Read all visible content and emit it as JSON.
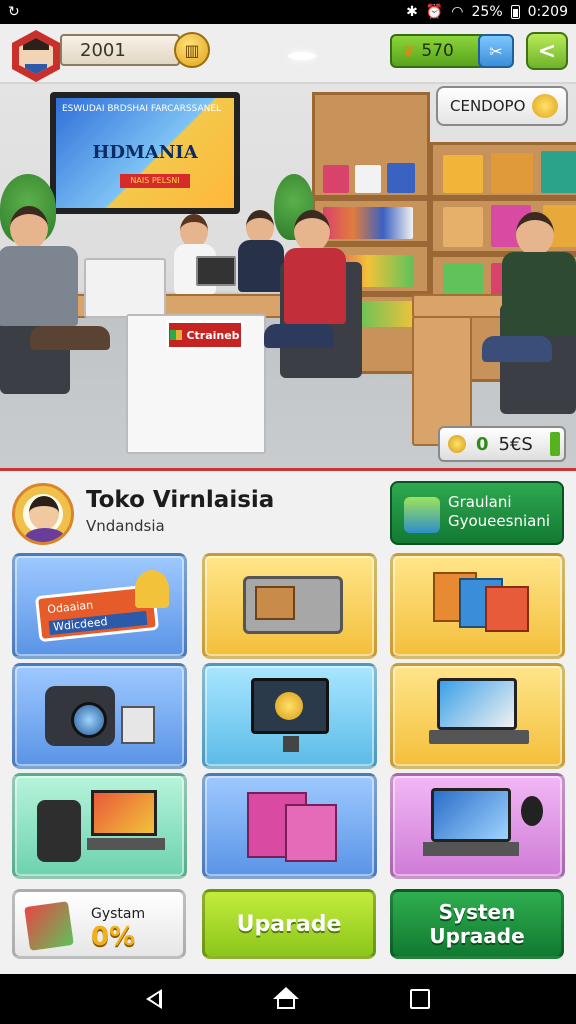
{
  "status_bar": {
    "time": "0:209",
    "battery": "25%"
  },
  "hud": {
    "score": "2001",
    "coins": "570",
    "shop_label": "CENDOPO",
    "mini_counter_prefix": "0",
    "mini_counter_value": "5€S"
  },
  "scene": {
    "tv_headline": "ESWUDAI BRDSHAI FARCARSSANEL",
    "tv_title": "HDMANIA",
    "tv_banner": "NAIS PELSNI",
    "desk_sign": "Ctraineb"
  },
  "profile": {
    "name": "Toko Virnlaisia",
    "subtitle": "Vndandsia"
  },
  "green_button": {
    "line1": "Graulani",
    "line2": "Gyoueesniani"
  },
  "tiles": [
    {
      "label_line1": "Odaaian",
      "label_line2": "Wdicdeed"
    }
  ],
  "bottom_buttons": {
    "system_label": "Gystam",
    "system_value": "0%",
    "upgrade": "Uparade",
    "system_upgrade_line1": "Systen",
    "system_upgrade_line2": "Upraade"
  },
  "colors": {
    "accent_red": "#c62323",
    "accent_green": "#137a33",
    "accent_lime": "#8cc61a",
    "tile_blue": "#5a94e6",
    "tile_yellow": "#f3bf3a"
  },
  "icons": [
    "wheat-icon",
    "tool-icon",
    "back-arrow-icon",
    "coin-icon",
    "paint-icon"
  ]
}
